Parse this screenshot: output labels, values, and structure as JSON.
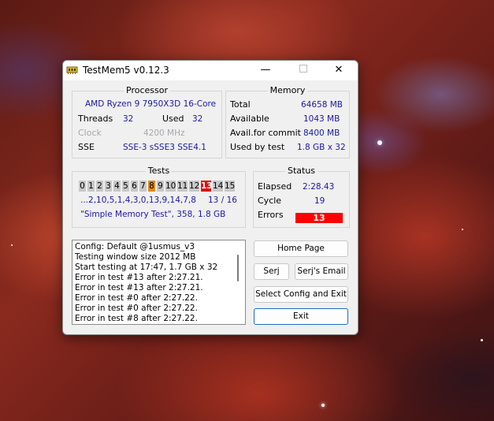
{
  "window": {
    "title": "TestMem5 v0.12.3"
  },
  "processor": {
    "title": "Processor",
    "name": "AMD Ryzen 9 7950X3D 16-Core",
    "threads_label": "Threads",
    "threads_value": "32",
    "used_label": "Used",
    "used_value": "32",
    "clock_label": "Clock",
    "clock_value": "4200 MHz",
    "sse_label": "SSE",
    "sse_value": "SSE-3 sSSE3 SSE4.1"
  },
  "memory": {
    "title": "Memory",
    "total_label": "Total",
    "total_value": "64658 MB",
    "available_label": "Available",
    "available_value": "1043 MB",
    "commit_label": "Avail.for commit",
    "commit_value": "8400 MB",
    "used_label": "Used by test",
    "used_value": "1.8 GB x 32"
  },
  "tests": {
    "title": "Tests",
    "cells": [
      "0",
      "1",
      "2",
      "3",
      "4",
      "5",
      "6",
      "7",
      "8",
      "9",
      "10",
      "11",
      "12",
      "13",
      "14",
      "15"
    ],
    "active_index": 8,
    "error_index": 13,
    "sequence": "...2,10,5,1,4,3,0,13,9,14,7,8",
    "progress": "13 / 16",
    "current": "\"Simple Memory Test\", 358, 1.8 GB"
  },
  "status": {
    "title": "Status",
    "elapsed_label": "Elapsed",
    "elapsed_value": "2:28.43",
    "cycle_label": "Cycle",
    "cycle_value": "19",
    "errors_label": "Errors",
    "errors_value": "13"
  },
  "log": [
    "Config: Default @1usmus_v3",
    "Testing window size 2012 MB",
    "Start testing at 17:47, 1.7 GB x 32",
    "Error in test #13 after 2:27.21.",
    "Error in test #13 after 2:27.21.",
    "Error in test #0 after 2:27.22.",
    "Error in test #0 after 2:27.22.",
    "Error in test #8 after 2:27.22."
  ],
  "buttons": {
    "home": "Home Page",
    "serj": "Serj",
    "email": "Serj's Email",
    "config": "Select Config and Exit",
    "exit": "Exit"
  },
  "colors": {
    "error": "#ff0000",
    "active_test": "#e08a1e",
    "value_text": "#1a1aa0"
  }
}
